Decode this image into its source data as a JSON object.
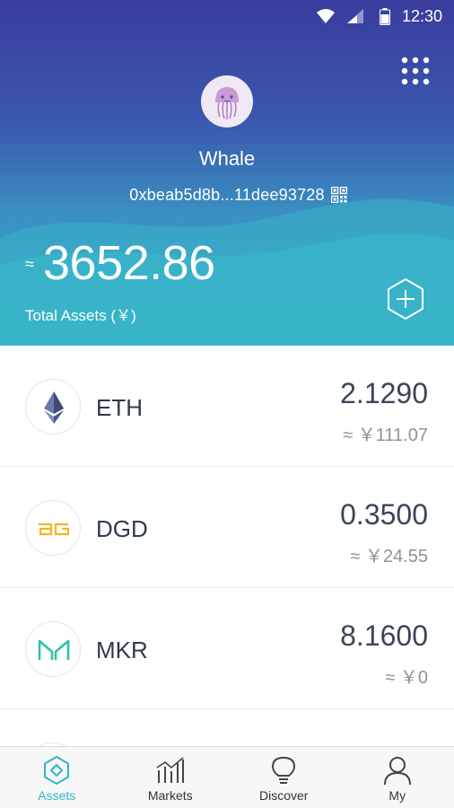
{
  "status_bar": {
    "time": "12:30"
  },
  "header": {
    "wallet_name": "Whale",
    "address": "0xbeab5d8b...11dee93728",
    "approx_symbol": "≈",
    "total_value": "3652.86",
    "total_label": "Total Assets (￥)"
  },
  "assets": [
    {
      "symbol": "ETH",
      "amount": "2.1290",
      "fiat": "≈ ￥111.07",
      "logo": "ethereum-logo"
    },
    {
      "symbol": "DGD",
      "amount": "0.3500",
      "fiat": "≈ ￥24.55",
      "logo": "digixdao-logo"
    },
    {
      "symbol": "MKR",
      "amount": "8.1600",
      "fiat": "≈ ￥0",
      "logo": "maker-logo"
    }
  ],
  "nav": [
    {
      "label": "Assets",
      "icon": "hexagon-icon",
      "active": true
    },
    {
      "label": "Markets",
      "icon": "chart-icon",
      "active": false
    },
    {
      "label": "Discover",
      "icon": "lightbulb-icon",
      "active": false
    },
    {
      "label": "My",
      "icon": "person-icon",
      "active": false
    }
  ],
  "colors": {
    "accent": "#2fb6c7",
    "header_top": "#3a3c9e",
    "header_bottom": "#35b2c9"
  }
}
